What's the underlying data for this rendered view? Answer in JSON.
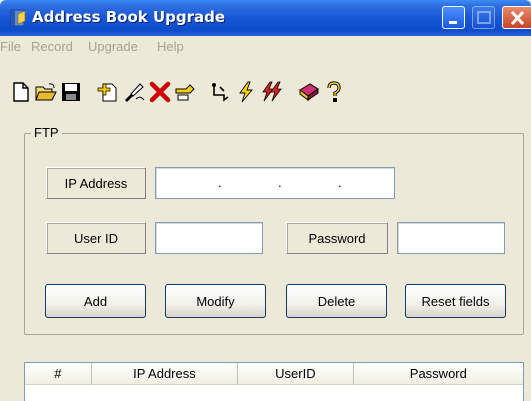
{
  "window": {
    "title": "Address Book Upgrade"
  },
  "menu": [
    "File",
    "Record",
    "Upgrade",
    "Help"
  ],
  "toolbar_icons": [
    "new-document-icon",
    "open-folder-icon",
    "save-icon",
    "add-record-icon",
    "edit-record-icon",
    "delete-record-icon",
    "undo-record-icon",
    "connect-icon",
    "upgrade-icon",
    "upgrade-all-icon",
    "book-icon",
    "help-icon"
  ],
  "ftp": {
    "group_label": "FTP",
    "ip_label": "IP Address",
    "ip_value": [
      "",
      "",
      "",
      ""
    ],
    "user_label": "User ID",
    "user_value": "",
    "password_label": "Password",
    "password_value": "",
    "buttons": {
      "add": "Add",
      "modify": "Modify",
      "delete": "Delete",
      "reset": "Reset fields"
    }
  },
  "list": {
    "columns": [
      "#",
      "IP Address",
      "UserID",
      "Password"
    ]
  },
  "colors": {
    "titlebar": "#0d4ccb",
    "face": "#ece9d8",
    "disabled_text": "#a5a195"
  }
}
